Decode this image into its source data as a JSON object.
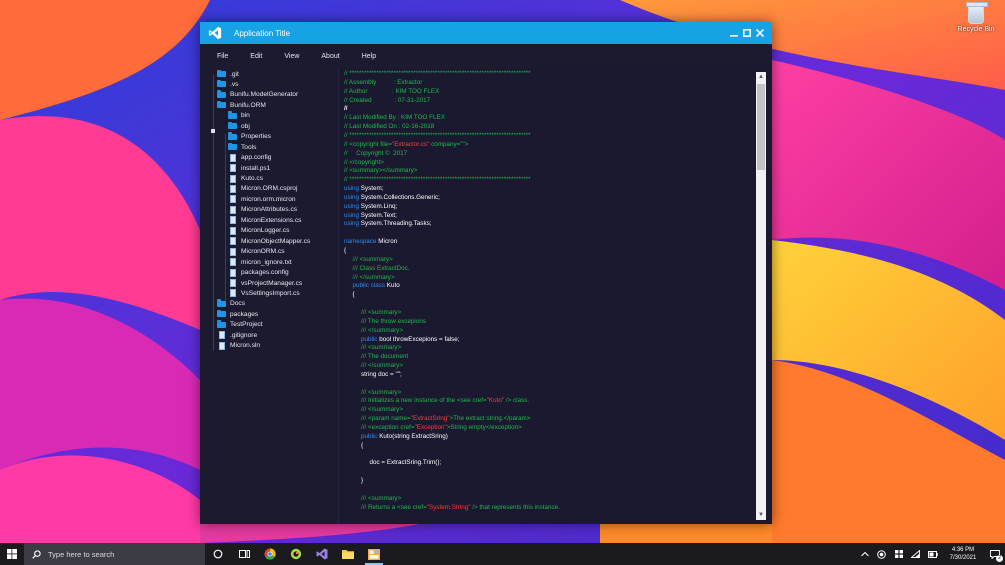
{
  "desktop": {
    "recycle_bin_label": "Recycle Bin"
  },
  "window": {
    "title": "Application Title",
    "controls": {
      "minimize_icon": "minimize-icon",
      "maximize_icon": "maximize-icon",
      "close_icon": "close-icon"
    },
    "accent_color": "#17a2e6"
  },
  "menu": {
    "items": [
      "File",
      "Edit",
      "View",
      "About",
      "Help"
    ]
  },
  "tree": {
    "items": [
      {
        "label": ".git",
        "type": "folder",
        "depth": 0
      },
      {
        "label": ".vs",
        "type": "folder",
        "depth": 0
      },
      {
        "label": "Bunifu.ModelGenerator",
        "type": "folder",
        "depth": 0
      },
      {
        "label": "Bunifu.ORM",
        "type": "folder",
        "depth": 0
      },
      {
        "label": "bin",
        "type": "folder",
        "depth": 1
      },
      {
        "label": "obj",
        "type": "folder",
        "depth": 1
      },
      {
        "label": "Properties",
        "type": "folder",
        "depth": 1
      },
      {
        "label": "Tools",
        "type": "folder",
        "depth": 1
      },
      {
        "label": "app.config",
        "type": "file",
        "depth": 1
      },
      {
        "label": "install.ps1",
        "type": "file",
        "depth": 1
      },
      {
        "label": "Kuto.cs",
        "type": "file",
        "depth": 1
      },
      {
        "label": "Micron.ORM.csproj",
        "type": "file",
        "depth": 1
      },
      {
        "label": "micron.orm.micron",
        "type": "file",
        "depth": 1
      },
      {
        "label": "MicronAttributes.cs",
        "type": "file",
        "depth": 1
      },
      {
        "label": "MicronExtensions.cs",
        "type": "file",
        "depth": 1
      },
      {
        "label": "MicronLogger.cs",
        "type": "file",
        "depth": 1
      },
      {
        "label": "MicronObjectMapper.cs",
        "type": "file",
        "depth": 1
      },
      {
        "label": "MicronORM.cs",
        "type": "file",
        "depth": 1
      },
      {
        "label": "micron_ignore.txt",
        "type": "file",
        "depth": 1
      },
      {
        "label": "packages.config",
        "type": "file",
        "depth": 1
      },
      {
        "label": "vsProjectManager.cs",
        "type": "file",
        "depth": 1
      },
      {
        "label": "VsSettingsImport.cs",
        "type": "file",
        "depth": 1
      },
      {
        "label": "Docs",
        "type": "folder",
        "depth": 0
      },
      {
        "label": "packages",
        "type": "folder",
        "depth": 0
      },
      {
        "label": "TestProject",
        "type": "folder",
        "depth": 0
      },
      {
        "label": ".gitignore",
        "type": "file",
        "depth": 0
      },
      {
        "label": "Micron.sln",
        "type": "file",
        "depth": 0
      }
    ]
  },
  "editor": {
    "colors": {
      "comment": "#22b94a",
      "keyword": "#2c8df5",
      "string": "#ff3b3b",
      "plain": "#ffffff"
    },
    "lines": [
      {
        "row": 0,
        "indent": 0,
        "tokens": [
          {
            "t": "c",
            "v": "// **************************************************************************"
          }
        ]
      },
      {
        "row": 1,
        "indent": 0,
        "tokens": [
          {
            "t": "c",
            "v": "// Assembly          : Extractor"
          }
        ]
      },
      {
        "row": 2,
        "indent": 0,
        "tokens": [
          {
            "t": "c",
            "v": "// Author              : KIM TOO FLEX"
          }
        ]
      },
      {
        "row": 3,
        "indent": 0,
        "tokens": [
          {
            "t": "c",
            "v": "// Created             : 07-31-2017"
          }
        ]
      },
      {
        "row": 4,
        "indent": 0,
        "tokens": [
          {
            "t": "p",
            "v": "//"
          }
        ]
      },
      {
        "row": 5,
        "indent": 0,
        "tokens": [
          {
            "t": "c",
            "v": "// Last Modified By : KIM TOO FLEX"
          }
        ]
      },
      {
        "row": 6,
        "indent": 0,
        "tokens": [
          {
            "t": "c",
            "v": "// Last Modified On : 02-16-2018"
          }
        ]
      },
      {
        "row": 7,
        "indent": 0,
        "tokens": [
          {
            "t": "c",
            "v": "// **************************************************************************"
          }
        ]
      },
      {
        "row": 8,
        "indent": 0,
        "tokens": [
          {
            "t": "c",
            "v": "// <copyright file="
          },
          {
            "t": "s",
            "v": "\"Extractor.cs\""
          },
          {
            "t": "c",
            "v": " company=\"\">"
          }
        ]
      },
      {
        "row": 9,
        "indent": 0,
        "tokens": [
          {
            "t": "c",
            "v": "//     Copyright ©  2017"
          }
        ]
      },
      {
        "row": 10,
        "indent": 0,
        "tokens": [
          {
            "t": "c",
            "v": "// </copyright>"
          }
        ]
      },
      {
        "row": 11,
        "indent": 0,
        "tokens": [
          {
            "t": "c",
            "v": "// <summary></summary>"
          }
        ]
      },
      {
        "row": 12,
        "indent": 0,
        "tokens": [
          {
            "t": "c",
            "v": "// **************************************************************************"
          }
        ]
      },
      {
        "row": 13,
        "indent": 0,
        "tokens": [
          {
            "t": "k",
            "v": "using"
          },
          {
            "t": "p",
            "v": " System;"
          }
        ]
      },
      {
        "row": 14,
        "indent": 0,
        "tokens": [
          {
            "t": "k",
            "v": "using"
          },
          {
            "t": "p",
            "v": " System.Collections.Generic;"
          }
        ]
      },
      {
        "row": 15,
        "indent": 0,
        "tokens": [
          {
            "t": "k",
            "v": "using"
          },
          {
            "t": "p",
            "v": " System.Linq;"
          }
        ]
      },
      {
        "row": 16,
        "indent": 0,
        "tokens": [
          {
            "t": "k",
            "v": "using"
          },
          {
            "t": "p",
            "v": " System.Text;"
          }
        ]
      },
      {
        "row": 17,
        "indent": 0,
        "tokens": [
          {
            "t": "k",
            "v": "using"
          },
          {
            "t": "p",
            "v": " System.Threading.Tasks;"
          }
        ]
      },
      {
        "row": 19,
        "indent": 0,
        "tokens": [
          {
            "t": "k",
            "v": "namespace"
          },
          {
            "t": "p",
            "v": " Micron"
          }
        ]
      },
      {
        "row": 20,
        "indent": 0,
        "tokens": [
          {
            "t": "p",
            "v": "{"
          }
        ]
      },
      {
        "row": 21,
        "indent": 1,
        "tokens": [
          {
            "t": "c",
            "v": "/// <summary>"
          }
        ]
      },
      {
        "row": 22,
        "indent": 1,
        "tokens": [
          {
            "t": "c",
            "v": "/// Class ExtractDoc."
          }
        ]
      },
      {
        "row": 23,
        "indent": 1,
        "tokens": [
          {
            "t": "c",
            "v": "/// </summary>"
          }
        ]
      },
      {
        "row": 24,
        "indent": 1,
        "tokens": [
          {
            "t": "k",
            "v": "public class"
          },
          {
            "t": "p",
            "v": " Kuto"
          }
        ]
      },
      {
        "row": 25,
        "indent": 1,
        "tokens": [
          {
            "t": "p",
            "v": "{"
          }
        ]
      },
      {
        "row": 27,
        "indent": 2,
        "tokens": [
          {
            "t": "c",
            "v": "/// <summary>"
          }
        ]
      },
      {
        "row": 28,
        "indent": 2,
        "tokens": [
          {
            "t": "c",
            "v": "/// The throw excepions"
          }
        ]
      },
      {
        "row": 29,
        "indent": 2,
        "tokens": [
          {
            "t": "c",
            "v": "/// </summary>"
          }
        ]
      },
      {
        "row": 30,
        "indent": 2,
        "tokens": [
          {
            "t": "k",
            "v": "public"
          },
          {
            "t": "p",
            "v": " bool throwExcepions = false;"
          }
        ]
      },
      {
        "row": 31,
        "indent": 2,
        "tokens": [
          {
            "t": "c",
            "v": "/// <summary>"
          }
        ]
      },
      {
        "row": 32,
        "indent": 2,
        "tokens": [
          {
            "t": "c",
            "v": "/// The document"
          }
        ]
      },
      {
        "row": 33,
        "indent": 2,
        "tokens": [
          {
            "t": "c",
            "v": "/// </summary>"
          }
        ]
      },
      {
        "row": 34,
        "indent": 2,
        "tokens": [
          {
            "t": "p",
            "v": "string doc = \"\";"
          }
        ]
      },
      {
        "row": 36,
        "indent": 2,
        "tokens": [
          {
            "t": "c",
            "v": "/// <summary>"
          }
        ]
      },
      {
        "row": 37,
        "indent": 2,
        "tokens": [
          {
            "t": "c",
            "v": "/// Initializes a new instance of the <see cref="
          },
          {
            "t": "s",
            "v": "\"Kuto\""
          },
          {
            "t": "c",
            "v": " /> class."
          }
        ]
      },
      {
        "row": 38,
        "indent": 2,
        "tokens": [
          {
            "t": "c",
            "v": "/// </summary>"
          }
        ]
      },
      {
        "row": 39,
        "indent": 2,
        "tokens": [
          {
            "t": "c",
            "v": "/// <param name="
          },
          {
            "t": "s",
            "v": "\"ExtractSring\""
          },
          {
            "t": "c",
            "v": ">The extract string.</param>"
          }
        ]
      },
      {
        "row": 40,
        "indent": 2,
        "tokens": [
          {
            "t": "c",
            "v": "/// <exception cref="
          },
          {
            "t": "s",
            "v": "\"Exception\""
          },
          {
            "t": "c",
            "v": ">String empty</exception>"
          }
        ]
      },
      {
        "row": 41,
        "indent": 2,
        "tokens": [
          {
            "t": "k",
            "v": "public"
          },
          {
            "t": "p",
            "v": " Kuto(string ExtractSring)"
          }
        ]
      },
      {
        "row": 42,
        "indent": 2,
        "tokens": [
          {
            "t": "p",
            "v": "{"
          }
        ]
      },
      {
        "row": 44,
        "indent": 3,
        "tokens": [
          {
            "t": "p",
            "v": "doc = ExtractSring.Trim();"
          }
        ]
      },
      {
        "row": 46,
        "indent": 2,
        "tokens": [
          {
            "t": "p",
            "v": "}"
          }
        ]
      },
      {
        "row": 48,
        "indent": 2,
        "tokens": [
          {
            "t": "c",
            "v": "/// <summary>"
          }
        ]
      },
      {
        "row": 49,
        "indent": 2,
        "tokens": [
          {
            "t": "c",
            "v": "/// Returns a <see cref="
          },
          {
            "t": "s",
            "v": "\"System.String\""
          },
          {
            "t": "c",
            "v": " /> that represents this instance."
          }
        ]
      }
    ]
  },
  "taskbar": {
    "search_placeholder": "Type here to search",
    "time": "4:36 PM",
    "date": "7/30/2021",
    "notification_count": "2"
  }
}
